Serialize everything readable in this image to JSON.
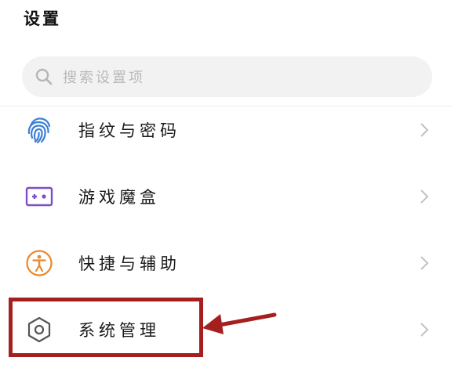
{
  "header": {
    "title": "设置"
  },
  "search": {
    "placeholder": "搜索设置项",
    "icon": "search-icon"
  },
  "settings": {
    "items": [
      {
        "label": "指纹与密码",
        "icon": "fingerprint-icon",
        "icon_color": "#3b7fd6"
      },
      {
        "label": "游戏魔盒",
        "icon": "game-box-icon",
        "icon_color": "#7a4fc9"
      },
      {
        "label": "快捷与辅助",
        "icon": "accessibility-icon",
        "icon_color": "#e8892b"
      },
      {
        "label": "系统管理",
        "icon": "gear-icon",
        "icon_color": "#555555"
      }
    ]
  },
  "annotation": {
    "highlight_color": "#a61f1f",
    "target": "系统管理"
  }
}
